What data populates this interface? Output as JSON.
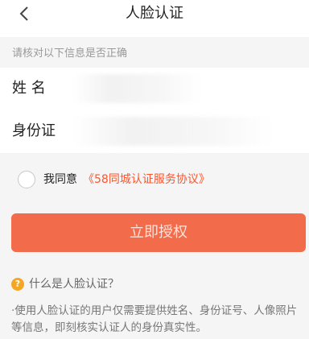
{
  "nav": {
    "title": "人脸认证"
  },
  "hint": "请核对以下信息是否正确",
  "form": {
    "name_label": "姓 名",
    "id_label": "身份证"
  },
  "agreement": {
    "prefix": "我同意",
    "link": "《58同城认证服务协议》"
  },
  "button": {
    "label": "立即授权"
  },
  "faq": {
    "icon_glyph": "?",
    "title": "什么是人脸认证？",
    "description": "·使用人脸认证的用户仅需要提供姓名、身份证号、人像照片等信息，即刻核实认证人的身份真实性。"
  },
  "colors": {
    "accent": "#ff552e",
    "button": "#f26b4a",
    "question_icon": "#f5a623"
  },
  "icons": {
    "back": "chevron-left-icon",
    "checkbox": "radio-circle-icon",
    "question": "question-circle-icon"
  }
}
